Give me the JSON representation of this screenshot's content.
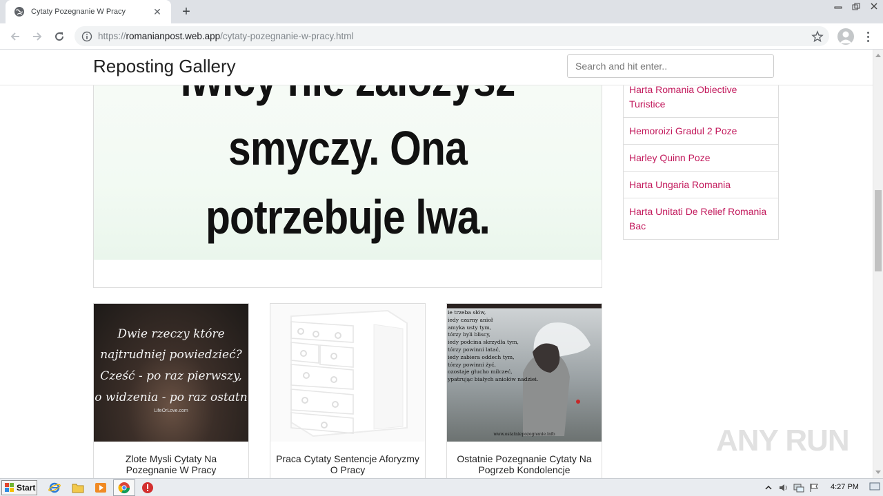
{
  "browser": {
    "tab_title": "Cytaty Pozegnanie W Pracy",
    "url_prefix": "https://",
    "url_host": "romanianpost.web.app",
    "url_path": "/cytaty-pozegnanie-w-pracy.html"
  },
  "site": {
    "brand": "Reposting Gallery",
    "search_placeholder": "Search and hit enter.."
  },
  "featured": {
    "lines": [
      "lwicy nie założysz",
      "smyczy. Ona",
      "potrzebuje lwa."
    ]
  },
  "sidebar": {
    "items": [
      {
        "label": "Harta Romania Obiective Turistice"
      },
      {
        "label": "Hemoroizi Gradul 2 Poze"
      },
      {
        "label": "Harley Quinn Poze"
      },
      {
        "label": "Harta Ungaria Romania"
      },
      {
        "label": "Harta Unitati De Relief Romania Bac"
      }
    ]
  },
  "thumbnails": [
    {
      "caption": "Zlote Mysli Cytaty Na Pozegnanie W Pracy",
      "image_lines": [
        "Dwie rzeczy które",
        "najtrudniej powiedzieć?",
        "Cześć - po raz pierwszy,",
        "o widzenia - po raz ostatn"
      ],
      "image_source": "LifeOrLove.com"
    },
    {
      "caption": "Praca Cytaty Sentencje Aforyzmy O Pracy"
    },
    {
      "caption": "Ostatnie Pozegnanie Cytaty Na Pogrzeb Kondolencje",
      "image_lines": [
        "ie trzeba słów,",
        "iedy czarny anioł",
        "amyka usty tym,",
        "tórzy byli bliscy,",
        "iedy podcina skrzydła tym,",
        "tórzy powinni latać,",
        "iedy zabiera oddech tym,",
        "tórzy powinni żyć,",
        "ozostaje głucho milczeć,",
        "ypatrując białych aniołów nadziei."
      ],
      "image_source": "www.ostatniepozegnanie.info"
    }
  ],
  "watermark": "ANY RUN",
  "taskbar": {
    "start_label": "Start",
    "clock": "4:27 PM"
  },
  "colors": {
    "sidebar_link": "#c2185b",
    "tabbar": "#dee1e6"
  }
}
